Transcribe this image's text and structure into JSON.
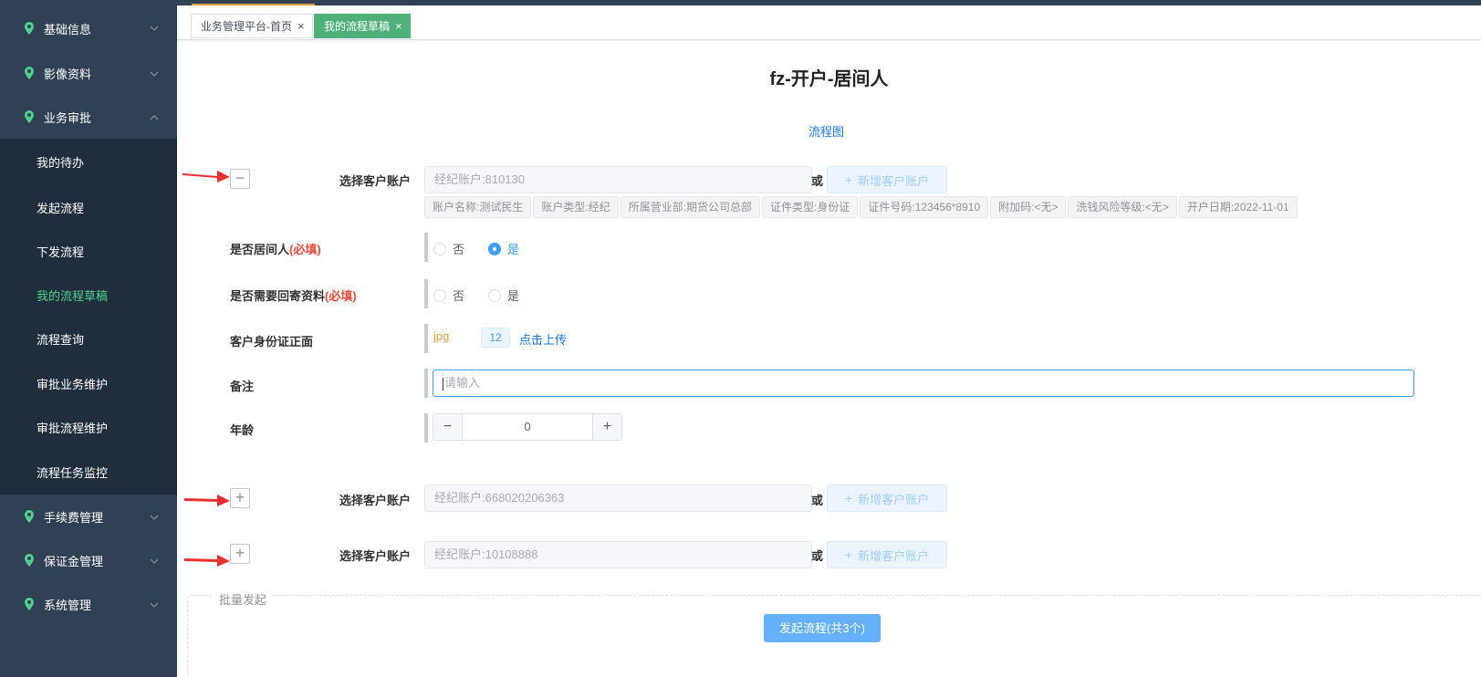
{
  "sidebar": {
    "groups_top": [
      {
        "label": "基础信息",
        "expanded": false
      },
      {
        "label": "影像资料",
        "expanded": false
      },
      {
        "label": "业务审批",
        "expanded": true
      }
    ],
    "sub_items": [
      {
        "label": "我的待办"
      },
      {
        "label": "发起流程"
      },
      {
        "label": "下发流程"
      },
      {
        "label": "我的流程草稿",
        "active": true
      },
      {
        "label": "流程查询"
      },
      {
        "label": "审批业务维护"
      },
      {
        "label": "审批流程维护"
      },
      {
        "label": "流程任务监控"
      }
    ],
    "groups_bottom": [
      {
        "label": "手续费管理"
      },
      {
        "label": "保证金管理"
      },
      {
        "label": "系统管理"
      }
    ]
  },
  "tabs": [
    {
      "label": "业务管理平台-首页",
      "close": "×",
      "active": false
    },
    {
      "label": "我的流程草稿",
      "close": "×",
      "active": true
    }
  ],
  "page": {
    "title": "fz-开户-居间人",
    "flow_link": "流程图"
  },
  "account_blocks": [
    {
      "label": "选择客户账户",
      "toggle": "−",
      "expanded": true,
      "input": "经纪账户:810130",
      "or": "或",
      "add_button": "新增客户账户",
      "tags": [
        "账户名称:测试民生",
        "账户类型:经纪",
        "所属营业部:期货公司总部",
        "证件类型:身份证",
        "证件号码:123456*8910",
        "附加码:<无>",
        "洗钱风险等级:<无>",
        "开户日期:2022-11-01"
      ]
    },
    {
      "label": "选择客户账户",
      "toggle": "+",
      "expanded": false,
      "input": "经纪账户:668020206363",
      "or": "或",
      "add_button": "新增客户账户"
    },
    {
      "label": "选择客户账户",
      "toggle": "+",
      "expanded": false,
      "input": "经纪账户:10108888",
      "or": "或",
      "add_button": "新增客户账户"
    }
  ],
  "form": {
    "is_intermediary": {
      "label": "是否居间人",
      "required": "(必填)",
      "options": [
        "否",
        "是"
      ],
      "selected": "是"
    },
    "need_return_docs": {
      "label": "是否需要回寄资料",
      "required": "(必填)",
      "options": [
        "否",
        "是"
      ],
      "selected": null
    },
    "id_front": {
      "label": "客户身份证正面",
      "ext": "jpg",
      "size_badge": "12",
      "upload_link": "点击上传"
    },
    "remark": {
      "label": "备注",
      "placeholder": "请输入",
      "value": ""
    },
    "age": {
      "label": "年龄",
      "value": "0",
      "minus": "−",
      "plus": "+"
    }
  },
  "batch": {
    "legend": "批量发起",
    "submit_button": "发起流程(共3个)"
  },
  "colors": {
    "sidebar_bg": "#304156",
    "submenu_bg": "#1f2d3d",
    "active_green": "#4fd08f",
    "tab_active": "#4fb07a",
    "primary_blue": "#409eff",
    "required_red": "#e84c3d",
    "arrow_red": "#e8312f"
  }
}
